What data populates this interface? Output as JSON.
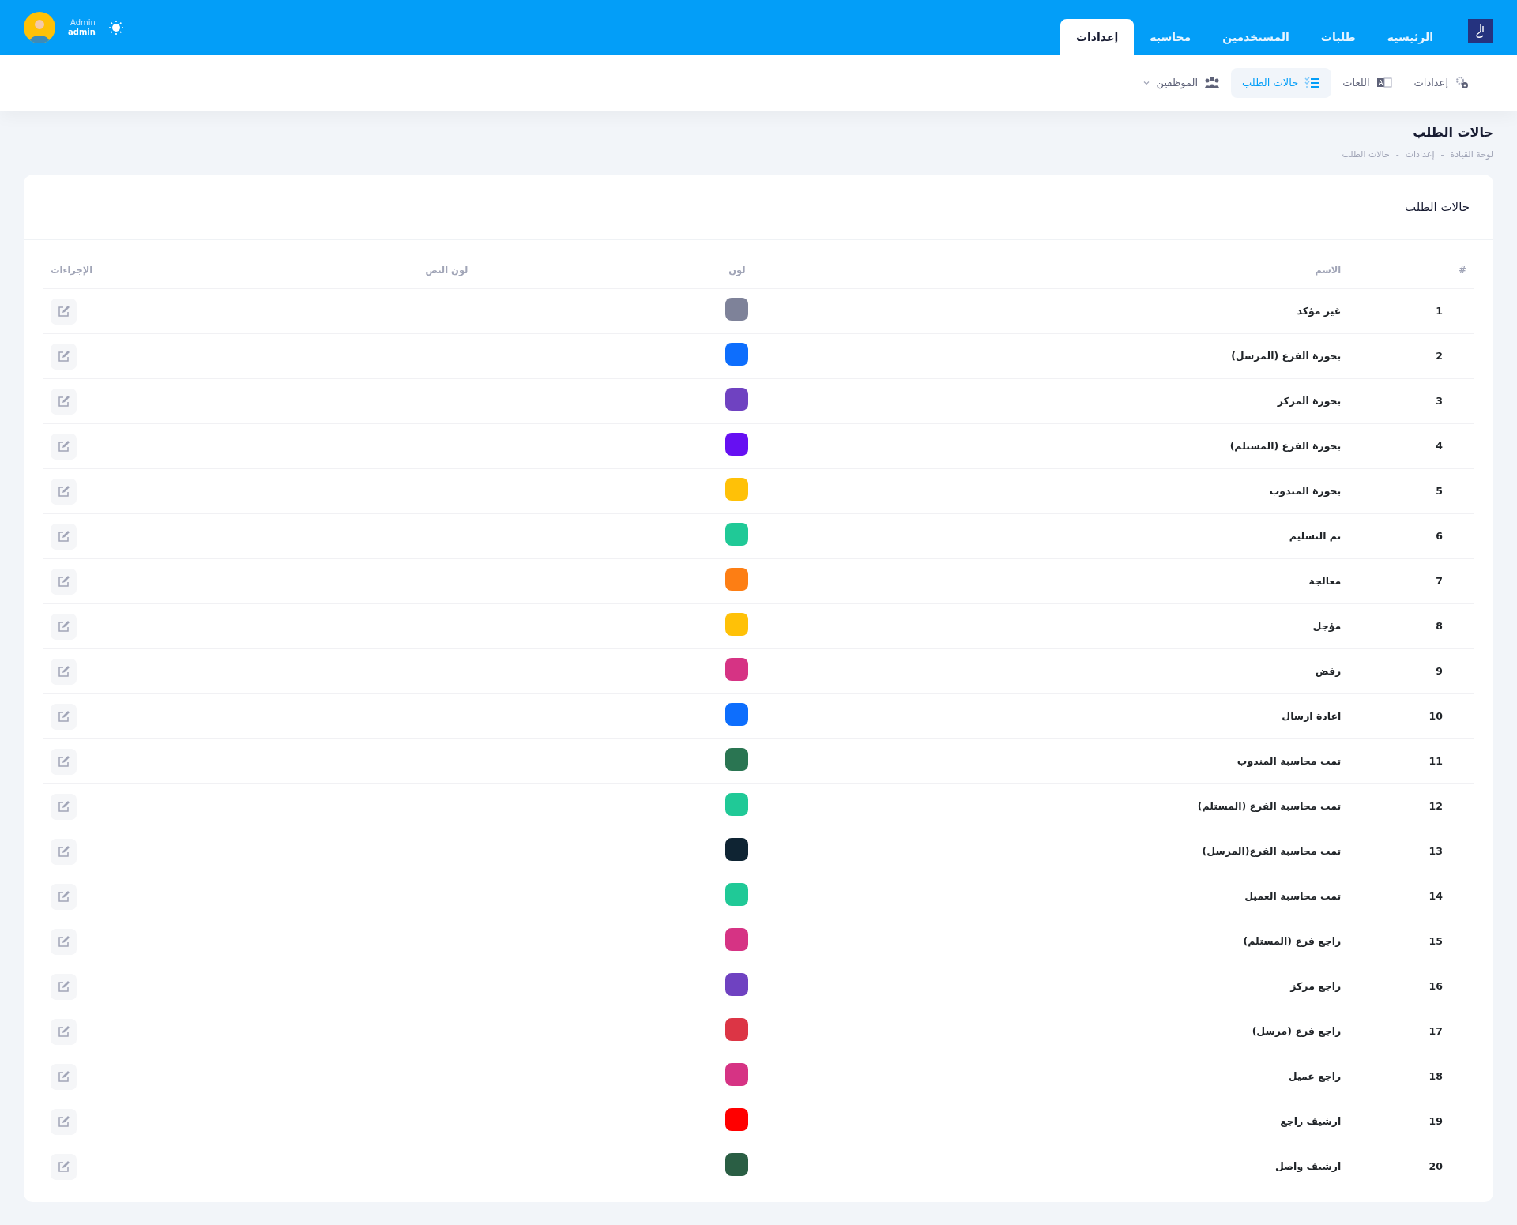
{
  "topbar": {
    "nav": [
      {
        "label": "الرئيسية",
        "selected": false
      },
      {
        "label": "طلبات",
        "selected": false
      },
      {
        "label": "المستخدمين",
        "selected": false
      },
      {
        "label": "محاسبة",
        "selected": false
      },
      {
        "label": "إعدادات",
        "selected": true
      }
    ],
    "user": {
      "role": "Admin",
      "name": "admin"
    }
  },
  "subnav": [
    {
      "label": "إعدادات",
      "kind": "gears",
      "selected": false,
      "dropdown": false
    },
    {
      "label": "اللغات",
      "kind": "language",
      "selected": false,
      "dropdown": false
    },
    {
      "label": "حالات الطلب",
      "kind": "list",
      "selected": true,
      "dropdown": false
    },
    {
      "label": "الموظفين",
      "kind": "users",
      "selected": false,
      "dropdown": true
    }
  ],
  "page": {
    "title": "حالات الطلب",
    "breadcrumb": [
      "لوحة القيادة",
      "إعدادات",
      "حالات الطلب"
    ],
    "separator": "-"
  },
  "card": {
    "title": "حالات الطلب",
    "table": {
      "columns": [
        "#",
        "الاسم",
        "لون",
        "لون النص",
        "الإجراءات"
      ],
      "rows": [
        {
          "number": "1",
          "name": "غير مؤكد",
          "color": "#7e8299"
        },
        {
          "number": "2",
          "name": "بحوزة الفرع (المرسل)",
          "color": "#0d6efd"
        },
        {
          "number": "3",
          "name": "بحوزة المركز",
          "color": "#6f42c1"
        },
        {
          "number": "4",
          "name": "بحوزة الفرع (المستلم)",
          "color": "#6610f2"
        },
        {
          "number": "5",
          "name": "بحوزة المندوب",
          "color": "#ffc107"
        },
        {
          "number": "6",
          "name": "تم التسليم",
          "color": "#20c997"
        },
        {
          "number": "7",
          "name": "معالجة",
          "color": "#fd7e14"
        },
        {
          "number": "8",
          "name": "مؤجل",
          "color": "#ffc107"
        },
        {
          "number": "9",
          "name": "رفض",
          "color": "#d63384"
        },
        {
          "number": "10",
          "name": "اعادة ارسال",
          "color": "#0d6efd"
        },
        {
          "number": "11",
          "name": "تمت محاسبة المندوب",
          "color": "#2a7552"
        },
        {
          "number": "12",
          "name": "تمت محاسبة الفرع (المستلم)",
          "color": "#20c997"
        },
        {
          "number": "13",
          "name": "تمت محاسبة الفرع(المرسل)",
          "color": "#0f2433"
        },
        {
          "number": "14",
          "name": "تمت محاسبة العميل",
          "color": "#20c997"
        },
        {
          "number": "15",
          "name": "راجع فرع (المستلم)",
          "color": "#d63384"
        },
        {
          "number": "16",
          "name": "راجع مركز",
          "color": "#6f42c1"
        },
        {
          "number": "17",
          "name": "راجع فرع (مرسل)",
          "color": "#dc3545"
        },
        {
          "number": "18",
          "name": "راجع عميل",
          "color": "#d63384"
        },
        {
          "number": "19",
          "name": "ارشيف راجع",
          "color": "#ff0000"
        },
        {
          "number": "20",
          "name": "ارشيف واصل",
          "color": "#2a5e44"
        }
      ]
    }
  }
}
